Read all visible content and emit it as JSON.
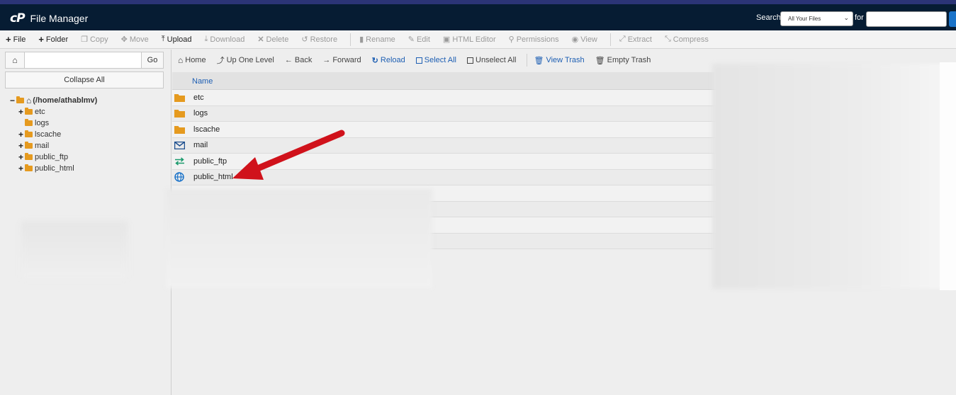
{
  "app": {
    "title": "File Manager",
    "logo_text": "cP"
  },
  "search": {
    "label": "Search",
    "scope_value": "All Your Files",
    "for_label": "for",
    "query_value": ""
  },
  "toolbar": {
    "items": [
      {
        "label": "File",
        "icon": "plus-icon",
        "enabled": true
      },
      {
        "label": "Folder",
        "icon": "plus-icon",
        "enabled": true
      },
      {
        "label": "Copy",
        "icon": "copy-icon",
        "enabled": false
      },
      {
        "label": "Move",
        "icon": "move-icon",
        "enabled": false
      },
      {
        "label": "Upload",
        "icon": "upload-icon",
        "enabled": true
      },
      {
        "label": "Download",
        "icon": "download-icon",
        "enabled": false
      },
      {
        "label": "Delete",
        "icon": "delete-icon",
        "enabled": false
      },
      {
        "label": "Restore",
        "icon": "restore-icon",
        "enabled": false
      },
      {
        "label": "Rename",
        "icon": "rename-icon",
        "enabled": false
      },
      {
        "label": "Edit",
        "icon": "pencil-icon",
        "enabled": false
      },
      {
        "label": "HTML Editor",
        "icon": "html-editor-icon",
        "enabled": false
      },
      {
        "label": "Permissions",
        "icon": "key-icon",
        "enabled": false
      },
      {
        "label": "View",
        "icon": "eye-icon",
        "enabled": false
      },
      {
        "label": "Extract",
        "icon": "extract-icon",
        "enabled": false
      },
      {
        "label": "Compress",
        "icon": "compress-icon",
        "enabled": false
      }
    ]
  },
  "left": {
    "path_value": "",
    "go_label": "Go",
    "collapse_label": "Collapse All",
    "root_label": "(/home/athablmv)",
    "tree": [
      {
        "label": "etc",
        "toggle": "+"
      },
      {
        "label": "logs",
        "toggle": ""
      },
      {
        "label": "lscache",
        "toggle": "+"
      },
      {
        "label": "mail",
        "toggle": "+"
      },
      {
        "label": "public_ftp",
        "toggle": "+"
      },
      {
        "label": "public_html",
        "toggle": "+"
      }
    ]
  },
  "main_toolbar": {
    "home": "Home",
    "up": "Up One Level",
    "back": "Back",
    "forward": "Forward",
    "reload": "Reload",
    "select_all": "Select All",
    "unselect_all": "Unselect All",
    "view_trash": "View Trash",
    "empty_trash": "Empty Trash"
  },
  "table": {
    "header_name": "Name",
    "files": [
      {
        "name": "etc",
        "icon": "folder-icon"
      },
      {
        "name": "logs",
        "icon": "folder-icon"
      },
      {
        "name": "lscache",
        "icon": "folder-icon"
      },
      {
        "name": "mail",
        "icon": "mail-icon"
      },
      {
        "name": "public_ftp",
        "icon": "transfer-icon"
      },
      {
        "name": "public_html",
        "icon": "globe-icon"
      }
    ]
  },
  "colors": {
    "topbar": "#061c33",
    "accent": "#1e5fb3",
    "folder": "#e59a1f",
    "arrow": "#d0121b"
  }
}
